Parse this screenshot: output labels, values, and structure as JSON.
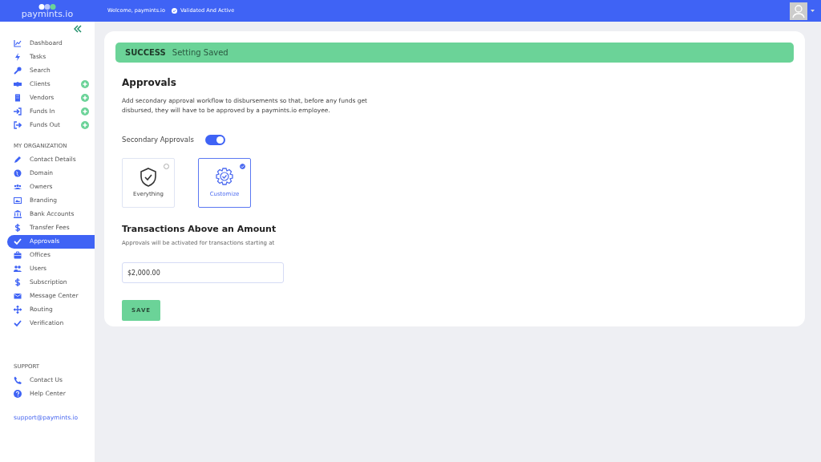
{
  "topbar": {
    "logo": "paymints.io",
    "welcome": "Welcome, paymints.io",
    "status": "Validated And Active"
  },
  "sidebar": {
    "main_items": [
      {
        "label": "Dashboard",
        "selected": false,
        "add_button": false
      },
      {
        "label": "Tasks",
        "selected": false,
        "add_button": false
      },
      {
        "label": "Search",
        "selected": false,
        "add_button": false
      },
      {
        "label": "Clients",
        "selected": false,
        "add_button": true
      },
      {
        "label": "Vendors",
        "selected": false,
        "add_button": true
      },
      {
        "label": "Funds In",
        "selected": false,
        "add_button": true
      },
      {
        "label": "Funds Out",
        "selected": false,
        "add_button": true
      }
    ],
    "org_heading": "MY ORGANIZATION",
    "org_items": [
      {
        "label": "Contact Details",
        "selected": false
      },
      {
        "label": "Domain",
        "selected": false
      },
      {
        "label": "Owners",
        "selected": false
      },
      {
        "label": "Branding",
        "selected": false
      },
      {
        "label": "Bank Accounts",
        "selected": false
      },
      {
        "label": "Transfer Fees",
        "selected": false
      },
      {
        "label": "Approvals",
        "selected": true
      },
      {
        "label": "Offices",
        "selected": false
      },
      {
        "label": "Users",
        "selected": false
      },
      {
        "label": "Subscription",
        "selected": false
      },
      {
        "label": "Message Center",
        "selected": false
      },
      {
        "label": "Routing",
        "selected": false
      },
      {
        "label": "Verification",
        "selected": false
      }
    ],
    "support_heading": "SUPPORT",
    "support_items": [
      {
        "label": "Contact Us",
        "selected": false
      },
      {
        "label": "Help Center",
        "selected": false
      }
    ],
    "email": "support@paymints.io"
  },
  "alert": {
    "title": "SUCCESS",
    "message": "Setting Saved"
  },
  "approvals": {
    "title": "Approvals",
    "description": "Add secondary approval workflow to disbursements so that, before any funds get disbursed, they will have to be approved by a paymints.io employee.",
    "toggle": {
      "label": "Secondary Approvals",
      "on": true
    },
    "options": [
      {
        "label": "Everything",
        "selected": false
      },
      {
        "label": "Customize",
        "selected": true
      }
    ]
  },
  "amount": {
    "title": "Transactions Above an Amount",
    "description": "Approvals will be activated for transactions starting at",
    "value": "$2,000.00"
  },
  "save_button": "SAVE"
}
